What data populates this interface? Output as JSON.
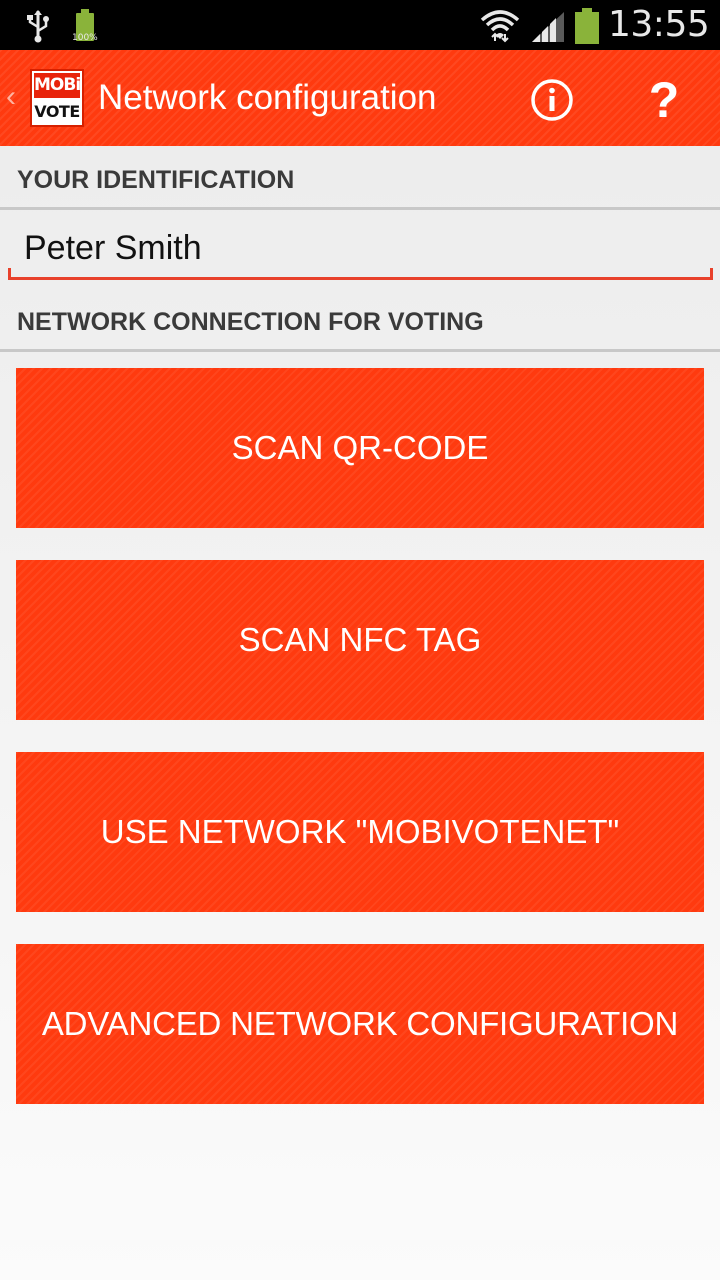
{
  "status_bar": {
    "battery_small_label": "100%",
    "time": "13:55"
  },
  "action_bar": {
    "logo_top": "MOBi",
    "logo_bottom": "VOTE",
    "title": "Network configuration",
    "help_symbol": "?"
  },
  "identification": {
    "header": "YOUR IDENTIFICATION",
    "name_value": "Peter Smith"
  },
  "network": {
    "header": "NETWORK CONNECTION FOR VOTING",
    "buttons": [
      {
        "label": "SCAN QR-CODE"
      },
      {
        "label": "SCAN NFC TAG"
      },
      {
        "label": "USE NETWORK \"MOBIVOTENET\""
      },
      {
        "label": "ADVANCED NETWORK CONFIGURATION"
      }
    ]
  },
  "icons": [
    "usb-icon",
    "battery-small-icon",
    "wifi-icon",
    "signal-icon",
    "battery-icon",
    "back-chevron-icon",
    "info-icon",
    "help-icon"
  ],
  "colors": {
    "accent": "#ff3a0f",
    "underline": "#e8412b",
    "battery": "#8ab33a"
  }
}
